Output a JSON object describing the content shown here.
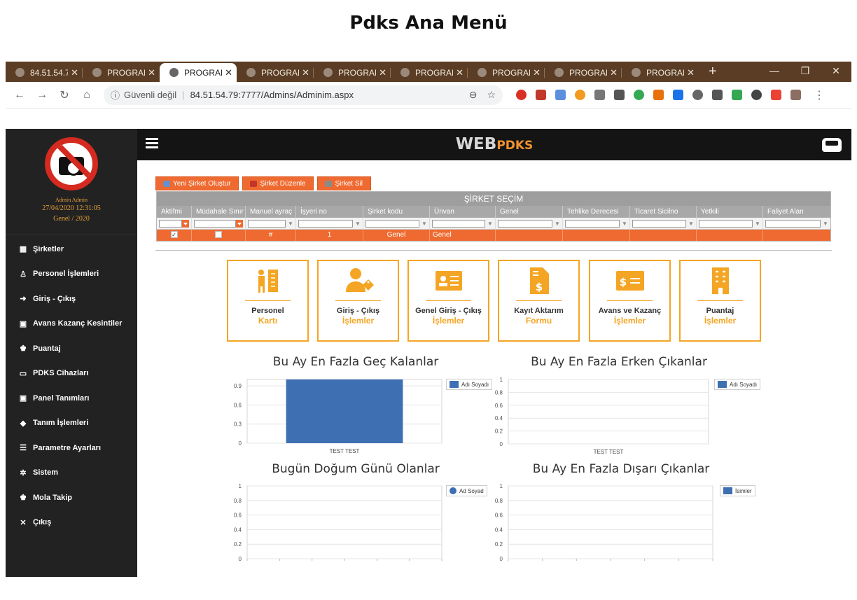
{
  "doc_title": "Pdks Ana Menü",
  "browser": {
    "tabs": [
      {
        "label": "84.51.54.7",
        "active": false
      },
      {
        "label": "PROGRAM",
        "active": false
      },
      {
        "label": "PROGRAM",
        "active": true
      },
      {
        "label": "PROGRAM",
        "active": false
      },
      {
        "label": "PROGRAM",
        "active": false
      },
      {
        "label": "PROGRAM",
        "active": false
      },
      {
        "label": "PROGRAM",
        "active": false
      },
      {
        "label": "PROGRAM",
        "active": false
      },
      {
        "label": "PROGRAM",
        "active": false
      }
    ],
    "security": "Güvenli değil",
    "url": "84.51.54.79:7777/Admins/Adminim.aspx",
    "extension_colors": [
      "#d93025",
      "#c0392b",
      "#5b8ede",
      "#f29b1e",
      "#777777",
      "#555555",
      "#34a853",
      "#e8710a",
      "#1a73e8",
      "#666666",
      "#555555",
      "#34a853",
      "#444444",
      "#ea4335",
      "#8d6e63"
    ]
  },
  "sidebar": {
    "user_name": "Admin Admin",
    "datetime": "27/04/2020 12:31:05",
    "period": "Genel / 2020",
    "menu": [
      {
        "label": "Şirketler",
        "icon": "building-icon"
      },
      {
        "label": "Personel İşlemleri",
        "icon": "user-icon"
      },
      {
        "label": "Giriş - Çıkış",
        "icon": "sign-in-icon"
      },
      {
        "label": "Avans Kazanç Kesintiler",
        "icon": "money-icon"
      },
      {
        "label": "Puantaj",
        "icon": "users-icon"
      },
      {
        "label": "PDKS Cihazları",
        "icon": "device-icon"
      },
      {
        "label": "Panel Tanımları",
        "icon": "panel-icon"
      },
      {
        "label": "Tanım İşlemleri",
        "icon": "tag-icon"
      },
      {
        "label": "Parametre Ayarları",
        "icon": "list-icon"
      },
      {
        "label": "Sistem",
        "icon": "cogs-icon"
      },
      {
        "label": "Mola Takip",
        "icon": "users-clock-icon"
      },
      {
        "label": "Çıkış",
        "icon": "close-icon"
      }
    ]
  },
  "header": {
    "brand_web": "WEB",
    "brand_pdks": "PDKS"
  },
  "company": {
    "buttons": [
      "Yeni Şirket Oluştur",
      "Şirket Düzenle",
      "Şirket Sil"
    ],
    "grid_title": "ŞİRKET SEÇİM",
    "columns": [
      "Aktifmi",
      "Müdahale Sınır",
      "Manuel ayraç",
      "İşyeri no",
      "Şirket kodu",
      "Ünvan",
      "Genel",
      "Tehlike Derecesi",
      "Ticaret Sicilno",
      "Yetkili",
      "Faliyet Alan"
    ],
    "row": {
      "aktif": "✓",
      "mudahale": "",
      "manuel": "#",
      "isyeri": "1",
      "kod": "Genel",
      "unvan": "Genel"
    }
  },
  "tiles": [
    {
      "line1": "Personel",
      "line2": "Kartı",
      "icon": "personnel-card-icon"
    },
    {
      "line1": "Giriş - Çıkış",
      "line2": "İşlemler",
      "icon": "user-tag-icon"
    },
    {
      "line1": "Genel Giriş - Çıkış",
      "line2": "İşlemler",
      "icon": "id-card-icon"
    },
    {
      "line1": "Kayıt Aktarım",
      "line2": "Formu",
      "icon": "invoice-icon"
    },
    {
      "line1": "Avans ve Kazanç",
      "line2": "İşlemler",
      "icon": "money-check-icon"
    },
    {
      "line1": "Puantaj",
      "line2": "İşlemler",
      "icon": "building-icon"
    }
  ],
  "chart_data": [
    {
      "type": "bar",
      "title": "Bu Ay En Fazla Geç Kalanlar",
      "categories": [
        "TEST TEST"
      ],
      "series": [
        {
          "name": "Adı Soyadı",
          "values": [
            1
          ]
        }
      ],
      "ylim": [
        0,
        1
      ],
      "yticks": [
        "0",
        "0.3",
        "0.6",
        "0.9"
      ],
      "legend": "top-right",
      "grid": true
    },
    {
      "type": "bar",
      "title": "Bu Ay En Fazla Erken Çıkanlar",
      "categories": [
        "TEST TEST"
      ],
      "series": [
        {
          "name": "Adı Soyadı",
          "values": [
            0
          ]
        }
      ],
      "ylim": [
        0,
        1
      ],
      "yticks": [
        "0",
        "0.2",
        "0.4",
        "0.6",
        "0.8",
        "1"
      ],
      "legend": "top-right",
      "grid": true
    },
    {
      "type": "line",
      "title": "Bugün Doğum Günü Olanlar",
      "categories": [],
      "series": [
        {
          "name": "Ad Soyad",
          "values": []
        }
      ],
      "ylim": [
        0,
        1
      ],
      "yticks": [
        "0",
        "0.2",
        "0.4",
        "0.6",
        "0.8",
        "1"
      ],
      "legend": "top-right",
      "grid": true
    },
    {
      "type": "bar",
      "title": "Bu Ay En Fazla Dışarı Çıkanlar",
      "categories": [],
      "series": [
        {
          "name": "İsimler",
          "values": []
        }
      ],
      "ylim": [
        0,
        1
      ],
      "yticks": [
        "0",
        "0.2",
        "0.4",
        "0.6",
        "0.8",
        "1"
      ],
      "legend": "top-right",
      "grid": true
    }
  ],
  "colors": {
    "accent": "#ef6a30",
    "tile_border": "#f4a523",
    "sidebar": "#222222",
    "header": "#141414",
    "bar": "#3f6fb3"
  }
}
